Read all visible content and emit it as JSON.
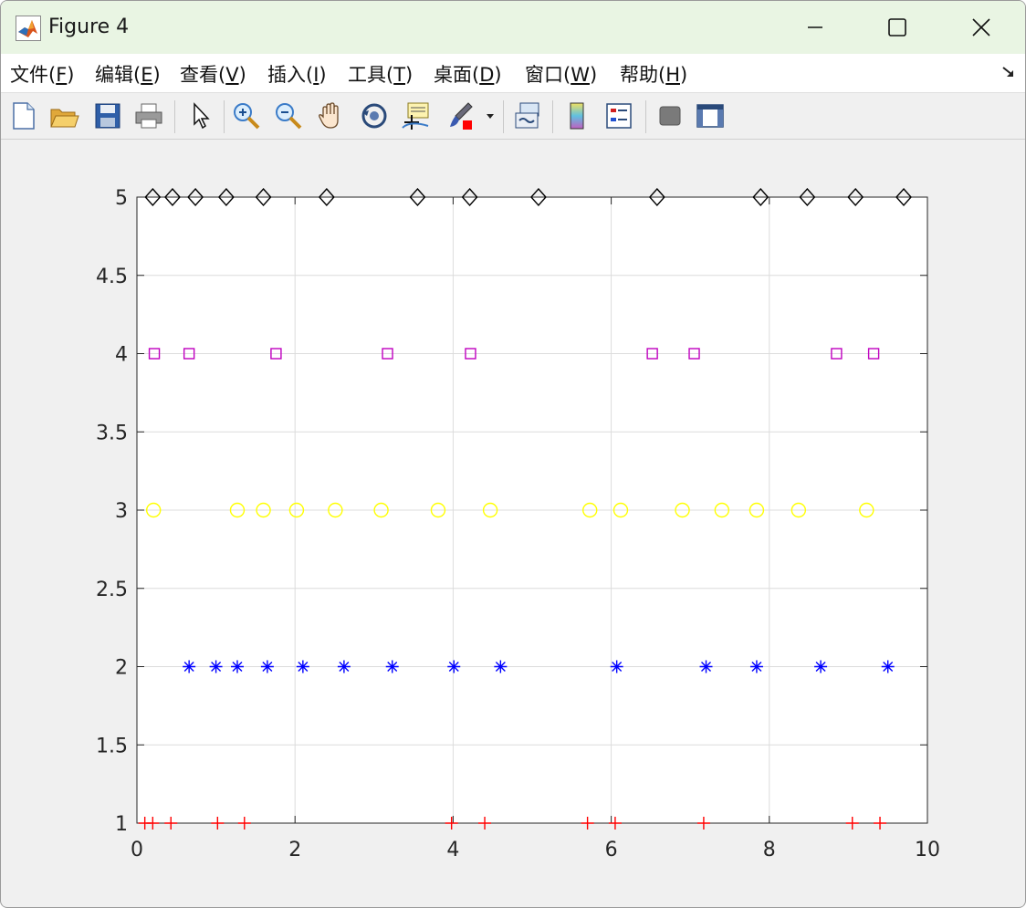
{
  "window": {
    "title": "Figure 4",
    "controls": {
      "minimize": "—",
      "maximize": "☐",
      "close": "✕"
    }
  },
  "menubar": {
    "items": [
      {
        "pre": "文件(",
        "key": "F",
        "post": ")"
      },
      {
        "pre": "编辑(",
        "key": "E",
        "post": ")"
      },
      {
        "pre": "查看(",
        "key": "V",
        "post": ")"
      },
      {
        "pre": "插入(",
        "key": "I",
        "post": ")"
      },
      {
        "pre": "工具(",
        "key": "T",
        "post": ")"
      },
      {
        "pre": "桌面(",
        "key": "D",
        "post": ")"
      },
      {
        "pre": "窗口(",
        "key": "W",
        "post": ")"
      },
      {
        "pre": "帮助(",
        "key": "H",
        "post": ")"
      }
    ],
    "dock_icon": "dock-arrow-icon"
  },
  "toolbar": {
    "icons": [
      "new-figure-icon",
      "open-file-icon",
      "save-icon",
      "print-icon",
      "pointer-icon",
      "zoom-in-icon",
      "zoom-out-icon",
      "pan-hand-icon",
      "rotate-3d-icon",
      "data-cursor-icon",
      "brush-icon",
      "brush-dropdown-icon",
      "link-plot-icon",
      "colorbar-icon",
      "legend-icon",
      "hide-plot-tools-icon",
      "show-plot-tools-icon"
    ]
  },
  "chart_data": {
    "type": "scatter",
    "title": "",
    "xlabel": "",
    "ylabel": "",
    "xlim": [
      0,
      10
    ],
    "ylim": [
      1,
      5
    ],
    "xticks": [
      0,
      2,
      4,
      6,
      8,
      10
    ],
    "yticks": [
      1,
      1.5,
      2,
      2.5,
      3,
      3.5,
      4,
      4.5,
      5
    ],
    "xtick_labels": [
      "0",
      "2",
      "4",
      "6",
      "8",
      "10"
    ],
    "ytick_labels": [
      "1",
      "1.5",
      "2",
      "2.5",
      "3",
      "3.5",
      "4",
      "4.5",
      "5"
    ],
    "grid": true,
    "series": [
      {
        "marker": "plus",
        "color": "#ff0000",
        "y": 1,
        "x": [
          0.1,
          0.2,
          0.43,
          1.02,
          1.36,
          3.98,
          4.4,
          5.7,
          6.05,
          7.17,
          9.05,
          9.4
        ]
      },
      {
        "marker": "asterisk",
        "color": "#0000ff",
        "y": 2,
        "x": [
          0.66,
          1.0,
          1.27,
          1.65,
          2.1,
          2.62,
          3.23,
          4.01,
          4.6,
          6.07,
          7.2,
          7.84,
          8.65,
          9.5
        ]
      },
      {
        "marker": "circle",
        "color": "#ffff00",
        "y": 3,
        "x": [
          0.21,
          1.27,
          1.6,
          2.02,
          2.51,
          3.09,
          3.81,
          4.47,
          5.73,
          6.12,
          6.9,
          7.4,
          7.84,
          8.37,
          9.23
        ]
      },
      {
        "marker": "square",
        "color": "#bf00bf",
        "y": 4,
        "x": [
          0.22,
          0.66,
          1.76,
          3.17,
          4.22,
          6.52,
          7.05,
          8.85,
          9.32
        ]
      },
      {
        "marker": "diamond",
        "color": "#000000",
        "y": 5,
        "x": [
          0.2,
          0.45,
          0.74,
          1.13,
          1.6,
          2.4,
          3.55,
          4.21,
          5.08,
          6.58,
          7.89,
          8.48,
          9.09,
          9.7
        ]
      }
    ]
  }
}
